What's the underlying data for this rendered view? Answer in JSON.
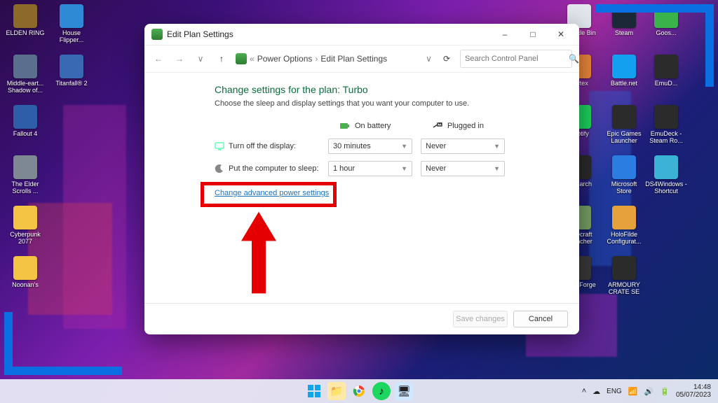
{
  "window": {
    "title": "Edit Plan Settings",
    "breadcrumbs": {
      "sep": "«",
      "a": "Power Options",
      "b": "Edit Plan Settings"
    },
    "search_placeholder": "Search Control Panel"
  },
  "content": {
    "heading": "Change settings for the plan: Turbo",
    "subtext": "Choose the sleep and display settings that you want your computer to use.",
    "col_battery": "On battery",
    "col_plugged": "Plugged in",
    "rows": {
      "display": {
        "label": "Turn off the display:",
        "battery": "30 minutes",
        "plugged": "Never"
      },
      "sleep": {
        "label": "Put the computer to sleep:",
        "battery": "1 hour",
        "plugged": "Never"
      }
    },
    "advanced_link": "Change advanced power settings"
  },
  "buttons": {
    "save": "Save changes",
    "cancel": "Cancel"
  },
  "taskbar": {
    "time": "14:48",
    "date": "05/07/2023"
  },
  "desktop": {
    "left1": [
      "ELDEN RING",
      "Middle-eart... Shadow of...",
      "Fallout 4",
      "The Elder Scrolls ...",
      "Cyberpunk 2077",
      "Noonan's"
    ],
    "left2": [
      "House Flipper...",
      "Titanfall® 2"
    ],
    "right0": [
      "Recycle Bin",
      "Vortex",
      "Spotify",
      "retroarch",
      "Minecraft Launcher",
      "CurseForge"
    ],
    "right1": [
      "Steam",
      "Battle.net",
      "Epic Games Launcher",
      "Microsoft Store",
      "HoloFilde Configurat...",
      "ARMOURY CRATE SE"
    ],
    "right2": [
      "Goos...",
      "EmuD...",
      "EmuDeck - Steam Ro...",
      "DS4Windows - Shortcut"
    ]
  },
  "icon_colors": {
    "left1": [
      "#8c6a2a",
      "#5a6e8e",
      "#2f5ea8",
      "#7d8893",
      "#f3c443",
      "#f3c443"
    ],
    "left2": [
      "#2f8ad6",
      "#3a69b3"
    ],
    "right0": [
      "#e3e8ef",
      "#f08a3c",
      "#1ed760",
      "#2b2b2b",
      "#7aa267",
      "#3a3a3a"
    ],
    "right1": [
      "#1b2838",
      "#12a0ef",
      "#2b2b2b",
      "#2b7de1",
      "#e5a23a",
      "#2b2b2b"
    ],
    "right2": [
      "#3ab34a",
      "#2b2b2b",
      "#2b2b2b",
      "#3ab3d6"
    ]
  }
}
